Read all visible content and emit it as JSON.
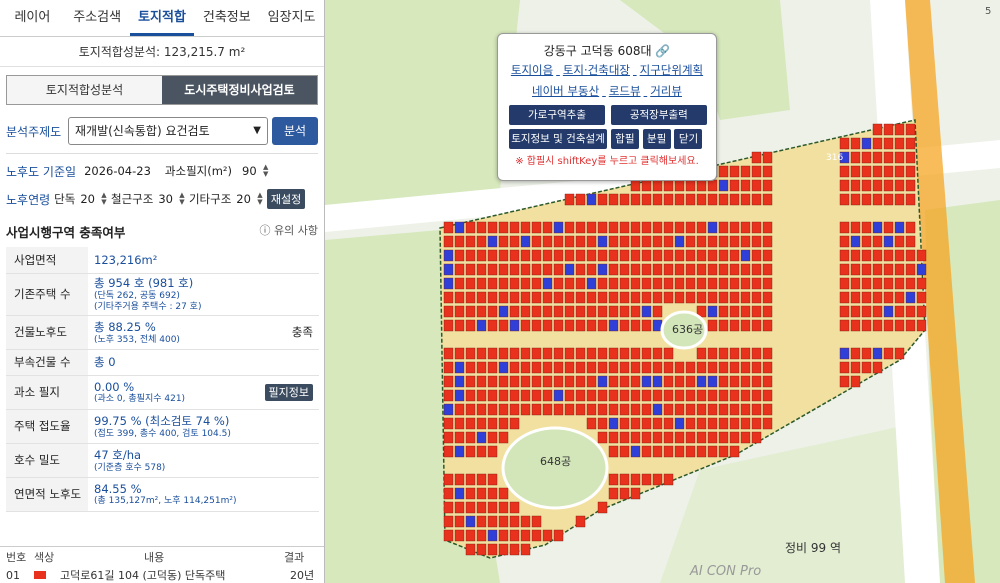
{
  "nav": {
    "tabs": [
      "레이어",
      "주소검색",
      "토지적합",
      "건축정보",
      "임장지도"
    ],
    "active": 2
  },
  "summary": "토지적합성분석: 123,215.7 m²",
  "subtabs": [
    "토지적합성분석",
    "도시주택정비사업검토"
  ],
  "analysis": {
    "label": "분석주제도",
    "selected": "재개발(신속통합) 요건검토",
    "button": "분석"
  },
  "aging": {
    "date_label": "노후도 기준일",
    "date": "2026-04-23",
    "small_lot_label": "과소필지(m²)",
    "small_lot": "90",
    "years_label": "노후연령",
    "wood_label": "단독",
    "wood": "20",
    "rc_label": "철근구조",
    "rc": "30",
    "other_label": "기타구조",
    "other": "20",
    "reset": "재설정"
  },
  "section": {
    "title": "사업시행구역 충족여부",
    "hint": "유의 사항"
  },
  "rows": [
    {
      "k": "사업면적",
      "v": "123,216m²",
      "s": "",
      "r": ""
    },
    {
      "k": "기존주택 수",
      "v": "총 954 호 (981 호)",
      "s": "(단독 262, 공동 692)",
      "s2": "(기타주거용 주택수 : 27 호)",
      "r": ""
    },
    {
      "k": "건물노후도",
      "v": "총 88.25 %",
      "s": "(노후 353, 전체 400)",
      "r": "충족"
    },
    {
      "k": "부속건물 수",
      "v": "총 0",
      "s": "",
      "r": ""
    },
    {
      "k": "과소 필지",
      "v": "0.00 %",
      "s": "(과소 0, 총필지수 421)",
      "r": "필지정보"
    },
    {
      "k": "주택 접도율",
      "v": "99.75 % (최소검토 74 %)",
      "s": "(접도 399, 총수 400, 검토 104.5)",
      "r": ""
    },
    {
      "k": "호수 밀도",
      "v": "47 호/ha",
      "s": "(기준층 호수 578)",
      "r": ""
    },
    {
      "k": "연면적 노후도",
      "v": "84.55 %",
      "s": "(총 135,127m², 노후 114,251m²)",
      "r": ""
    }
  ],
  "footer": {
    "h_no": "번호",
    "h_color": "색상",
    "h_content": "내용",
    "h_result": "결과",
    "row_no": "01",
    "row_content": "고덕로61길 104 (고덕동) 단독주택",
    "row_result": "20년"
  },
  "popup": {
    "title": "강동구 고덕동 608대",
    "links1": [
      "토지이음",
      "토지·건축대장",
      "지구단위계획"
    ],
    "links2": [
      "네이버 부동산",
      "로드뷰",
      "거리뷰"
    ],
    "b1": "가로구역추출",
    "b2": "공적장부출력",
    "b3": "토지정보 및 건축설계",
    "b4": "합필",
    "b5": "분필",
    "b6": "닫기",
    "note": "※ 합필시 shiftKey를 누르고 클릭해보세요."
  },
  "map_labels": [
    "648공",
    "636공",
    "정비 99 역",
    "316",
    "5"
  ],
  "map_watermark": "AI CON Pro",
  "colors": {
    "accent": "#1a4f9c",
    "parcel_red": "#e8321e",
    "parcel_blue": "#2f3fd8",
    "park": "#d3e6b9"
  }
}
